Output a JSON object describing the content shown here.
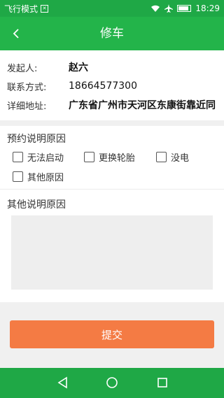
{
  "status_bar": {
    "left_text": "飞行模式",
    "time": "18:29",
    "icons": [
      "sim-icon",
      "wifi-icon",
      "airplane-icon",
      "battery-icon"
    ]
  },
  "app_bar": {
    "title": "修车",
    "back_icon": "chevron-left-icon"
  },
  "info": {
    "initiator_label": "发起人:",
    "initiator_value": "赵六",
    "contact_label": "联系方式:",
    "contact_value": "18664577300",
    "address_label": "详细地址:",
    "address_value": "广东省广州市天河区东康街靠近同"
  },
  "reason": {
    "title": "预约说明原因",
    "options": [
      "无法启动",
      "更换轮胎",
      "没电",
      "其他原因"
    ],
    "other_title": "其他说明原因",
    "other_value": ""
  },
  "submit_label": "提交",
  "colors": {
    "status_bar": "#1fa846",
    "app_bar": "#23b44a",
    "submit": "#f47b44",
    "nav_bar": "#1fa846"
  },
  "nav_bar": {
    "icons": [
      "back-triangle-icon",
      "home-circle-icon",
      "recents-square-icon"
    ]
  }
}
